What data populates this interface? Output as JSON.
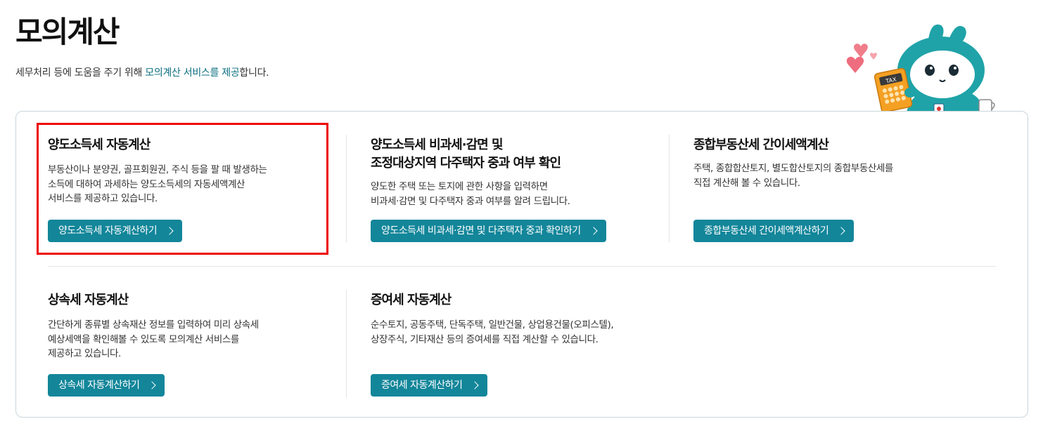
{
  "header": {
    "title": "모의계산",
    "description_prefix": "세무처리 등에 도움을 주기 위해 ",
    "description_highlight": "모의계산 서비스를 제공",
    "description_suffix": "합니다.",
    "mascot_badge": "TAX"
  },
  "cards": [
    {
      "title_line1": "양도소득세 자동계산",
      "title_line2": "",
      "desc": [
        "부동산이나 분양권, 골프회원권, 주식 등을 팔 때 발생하는",
        "소득에 대하여 과세하는 양도소득세의 자동세액계산",
        "서비스를 제공하고 있습니다."
      ],
      "button": "양도소득세 자동계산하기",
      "highlighted": true
    },
    {
      "title_line1": "양도소득세 비과세·감면 및",
      "title_line2": "조정대상지역 다주택자 중과 여부 확인",
      "desc": [
        "양도한 주택 또는 토지에 관한 사항을 입력하면",
        "비과세·감면 및 다주택자 중과 여부를 알려 드립니다."
      ],
      "button": "양도소득세 비과세·감면 및 다주택자 중과 확인하기"
    },
    {
      "title_line1": "종합부동산세 간이세액계산",
      "title_line2": "",
      "desc": [
        "주택, 종합합산토지, 별도합산토지의 종합부동산세를",
        "직접 계산해 볼 수 있습니다."
      ],
      "button": "종합부동산세 간이세액계산하기"
    },
    {
      "title_line1": "상속세 자동계산",
      "title_line2": "",
      "desc": [
        "간단하게 종류별 상속재산 정보를 입력하여 미리 상속세",
        "예상세액을 확인해볼 수 있도록 모의계산 서비스를",
        "제공하고 있습니다."
      ],
      "button": "상속세 자동계산하기"
    },
    {
      "title_line1": "증여세 자동계산",
      "title_line2": "",
      "desc": [
        "순수토지, 공동주택, 단독주택, 일반건물, 상업용건물(오피스텔),",
        "상장주식, 기타재산 등의 증여세를 직접 계산할 수 있습니다."
      ],
      "button": "증여세 자동계산하기"
    }
  ],
  "colors": {
    "accent": "#13869a",
    "highlight_text": "#0b6e80",
    "selection_box": "#ee0000",
    "mascot_body": "#1fa3a8"
  }
}
